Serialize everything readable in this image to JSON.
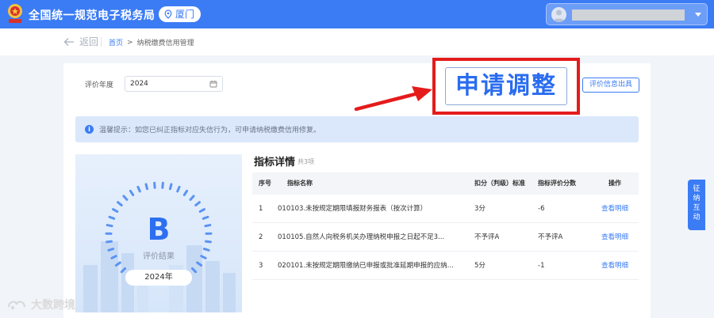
{
  "header": {
    "site_title": "全国统一规范电子税务局",
    "city": "厦门"
  },
  "breadcrumb": {
    "back_label": "返回",
    "home": "首页",
    "separator": ">",
    "current": "纳税缴费信用管理"
  },
  "filter": {
    "year_label": "评价年度",
    "year_value": "2024"
  },
  "actions": {
    "apply_adjust": "申请调整",
    "eval_info_issue": "评价信息出具"
  },
  "tip": {
    "text": "温馨提示：如您已纠正指标对应失信行为，可申请纳税缴费信用修复。"
  },
  "result": {
    "grade": "B",
    "grade_label": "评价结果",
    "year_label": "2024年"
  },
  "detail": {
    "title": "指标详情",
    "count": "共3项",
    "columns": [
      "序号",
      "指标名称",
      "扣分（判级）标准",
      "指标评价分数",
      "操作"
    ],
    "rows": [
      {
        "index": "1",
        "name": "010103.未按规定期限填报财务报表（按次计算）",
        "standard": "3分",
        "score": "-6",
        "action": "查看明细"
      },
      {
        "index": "2",
        "name": "010105.自然人向税务机关办理纳税申报之日起不足3...",
        "standard": "不予评A",
        "score": "不予评A",
        "action": "查看明细"
      },
      {
        "index": "3",
        "name": "020101.未按规定期限缴纳已申报或批准延期申报的应纳...",
        "standard": "5分",
        "score": "-1",
        "action": "查看明细"
      }
    ]
  },
  "side_button": {
    "line1": "征",
    "line2": "纳",
    "line3": "互",
    "line4": "动"
  },
  "watermark": "大数跨境",
  "colors": {
    "primary": "#3b7cf5",
    "annotation_red": "#e51b1b"
  }
}
